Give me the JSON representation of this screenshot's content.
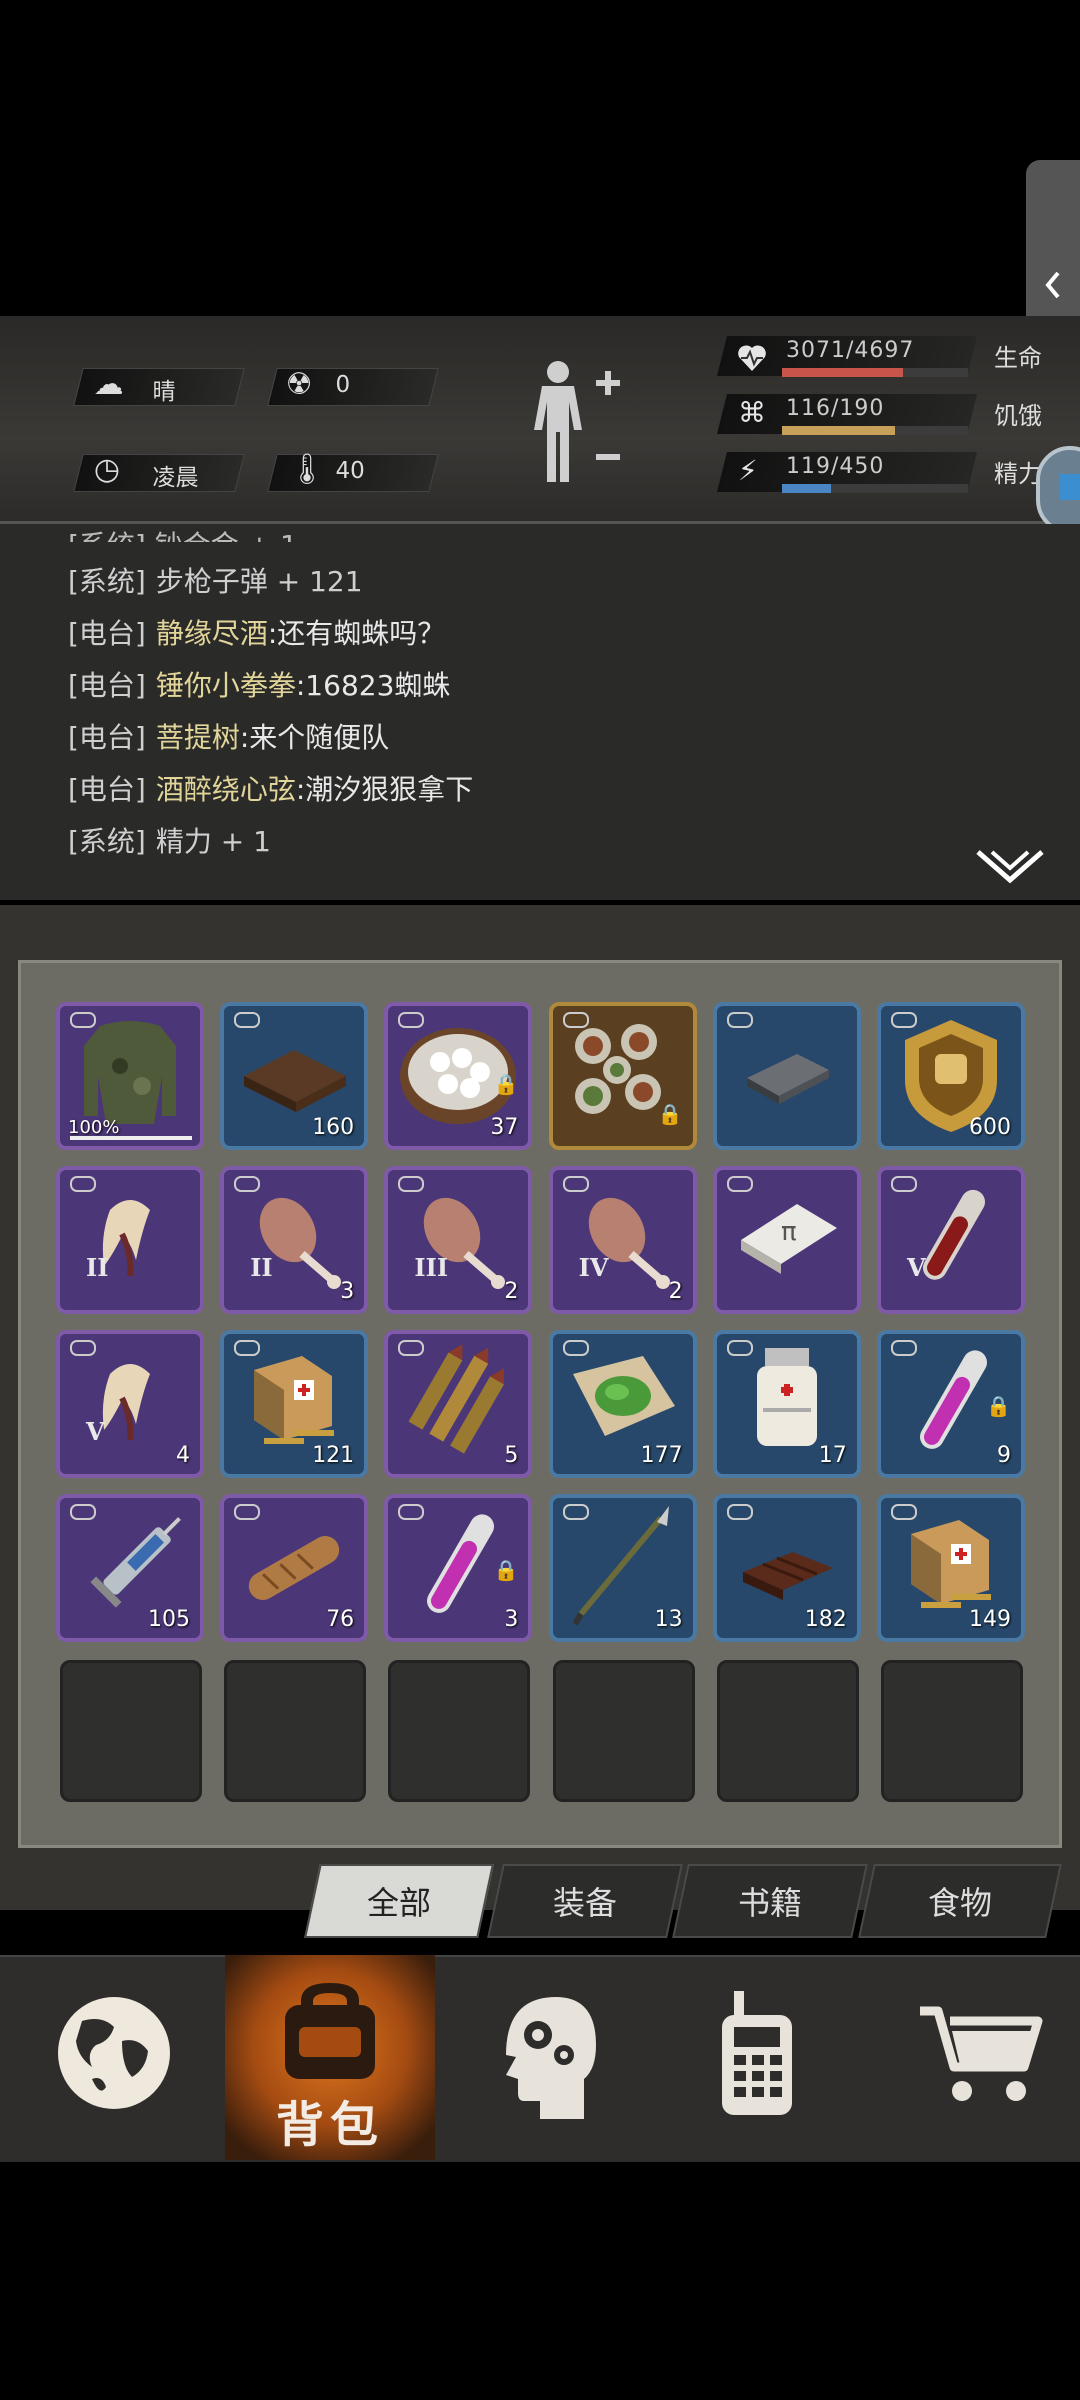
{
  "status": {
    "weather": "晴",
    "radiation": "0",
    "time_of_day": "凌晨",
    "temperature": "40",
    "health": {
      "text": "3071/4697",
      "label": "生命",
      "fraction": 0.653,
      "color": "#c8554a"
    },
    "hunger": {
      "text": "116/190",
      "label": "饥饿",
      "fraction": 0.61,
      "color": "#c8a05a"
    },
    "energy": {
      "text": "119/450",
      "label": "精力",
      "fraction": 0.264,
      "color": "#4a86c4"
    }
  },
  "log": [
    {
      "tag": "[系统]",
      "name": "",
      "text": "步枪子弹 + 121"
    },
    {
      "tag": "[电台]",
      "name": "静缘尽酒",
      "text": ":还有蜘蛛吗？"
    },
    {
      "tag": "[电台]",
      "name": "锤你小拳拳",
      "text": ":16823蜘蛛"
    },
    {
      "tag": "[电台]",
      "name": "菩提树",
      "text": ":来个随便队"
    },
    {
      "tag": "[电台]",
      "name": "酒醉绕心弦",
      "text": ":潮汐狠狠拿下"
    },
    {
      "tag": "[系统]",
      "name": "",
      "text": "精力 + 1"
    }
  ],
  "inventory": [
    {
      "icon": "camo-jacket-icon",
      "rarity": "purple",
      "qty": "100%"
    },
    {
      "icon": "wooden-tray-icon",
      "rarity": "blue",
      "qty": "160"
    },
    {
      "icon": "egg-basket-icon",
      "rarity": "purple",
      "qty": "37",
      "locked": true
    },
    {
      "icon": "feast-dishes-icon",
      "rarity": "gold",
      "qty": "",
      "locked": true
    },
    {
      "icon": "metal-ingot-icon",
      "rarity": "blue",
      "qty": ""
    },
    {
      "icon": "fist-badge-icon",
      "rarity": "blue",
      "qty": "600"
    },
    {
      "icon": "claw-icon",
      "rarity": "purple",
      "qty": "",
      "roman": "II"
    },
    {
      "icon": "drumstick-icon",
      "rarity": "purple",
      "qty": "3",
      "roman": "II"
    },
    {
      "icon": "drumstick-icon",
      "rarity": "purple",
      "qty": "2",
      "roman": "III"
    },
    {
      "icon": "drumstick-icon",
      "rarity": "purple",
      "qty": "2",
      "roman": "IV"
    },
    {
      "icon": "dogtag-icon",
      "rarity": "purple",
      "qty": ""
    },
    {
      "icon": "blood-vial-icon",
      "rarity": "purple",
      "qty": "",
      "roman": "V"
    },
    {
      "icon": "claw-icon",
      "rarity": "purple",
      "qty": "4",
      "roman": "V"
    },
    {
      "icon": "ammo-box-icon",
      "rarity": "blue",
      "qty": "121"
    },
    {
      "icon": "rifle-bullets-icon",
      "rarity": "purple",
      "qty": "5"
    },
    {
      "icon": "herb-cloth-icon",
      "rarity": "blue",
      "qty": "177"
    },
    {
      "icon": "medicine-bottle-icon",
      "rarity": "blue",
      "qty": "17"
    },
    {
      "icon": "pink-vial-icon",
      "rarity": "blue",
      "qty": "9",
      "locked": true
    },
    {
      "icon": "syringe-icon",
      "rarity": "purple",
      "qty": "105"
    },
    {
      "icon": "bread-icon",
      "rarity": "purple",
      "qty": "76"
    },
    {
      "icon": "pink-vial-icon",
      "rarity": "purple",
      "qty": "3",
      "locked": true
    },
    {
      "icon": "spear-icon",
      "rarity": "blue",
      "qty": "13"
    },
    {
      "icon": "chocolate-icon",
      "rarity": "blue",
      "qty": "182"
    },
    {
      "icon": "ammo-box-icon",
      "rarity": "blue",
      "qty": "149"
    }
  ],
  "tabs": [
    {
      "label": "全部",
      "active": true
    },
    {
      "label": "装备",
      "active": false
    },
    {
      "label": "书籍",
      "active": false
    },
    {
      "label": "食物",
      "active": false
    }
  ],
  "nav": {
    "globe_icon": "globe-icon",
    "backpack_label": "背包",
    "skills_icon": "head-gears-icon",
    "radio_icon": "radio-icon",
    "cart_icon": "cart-icon"
  }
}
